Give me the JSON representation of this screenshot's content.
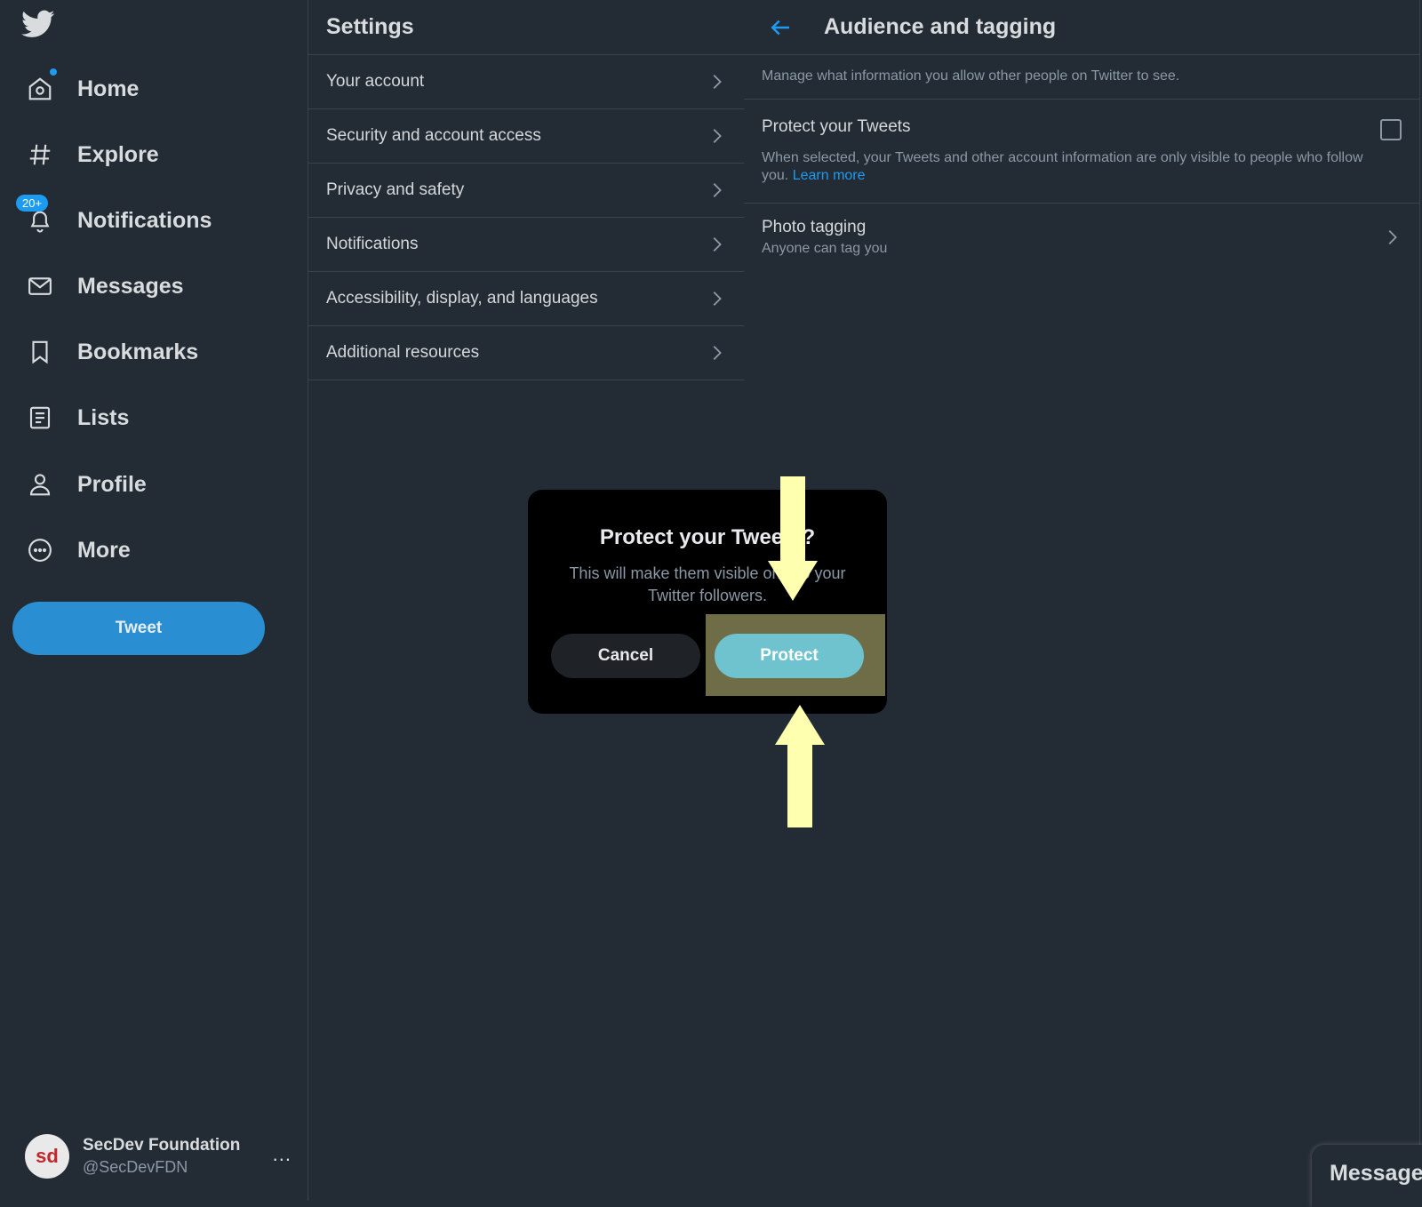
{
  "sidebar": {
    "items": [
      {
        "label": "Home",
        "icon": "home-icon"
      },
      {
        "label": "Explore",
        "icon": "hashtag-icon"
      },
      {
        "label": "Notifications",
        "icon": "bell-icon",
        "badge": "20+"
      },
      {
        "label": "Messages",
        "icon": "envelope-icon"
      },
      {
        "label": "Bookmarks",
        "icon": "bookmark-icon"
      },
      {
        "label": "Lists",
        "icon": "list-icon"
      },
      {
        "label": "Profile",
        "icon": "person-icon"
      },
      {
        "label": "More",
        "icon": "more-circle-icon"
      }
    ],
    "tweet_label": "Tweet",
    "account": {
      "name": "SecDev Foundation",
      "handle": "@SecDevFDN",
      "avatar_text": "sd",
      "more": "..."
    }
  },
  "settings": {
    "title": "Settings",
    "rows": [
      {
        "label": "Your account"
      },
      {
        "label": "Security and account access"
      },
      {
        "label": "Privacy and safety"
      },
      {
        "label": "Notifications"
      },
      {
        "label": "Accessibility, display, and languages"
      },
      {
        "label": "Additional resources"
      }
    ]
  },
  "detail": {
    "title": "Audience and tagging",
    "description": "Manage what information you allow other people on Twitter to see.",
    "protect": {
      "title": "Protect your Tweets",
      "desc": "When selected, your Tweets and other account information are only visible to people who follow you.",
      "link": "Learn more",
      "checked": false
    },
    "photo": {
      "title": "Photo tagging",
      "sub": "Anyone can tag you"
    }
  },
  "messages_drawer": {
    "label": "Messages"
  },
  "modal": {
    "title": "Protect your Tweets?",
    "text": "This will make them visible only to your Twitter followers.",
    "cancel": "Cancel",
    "protect": "Protect"
  },
  "colors": {
    "accent": "#1d9bf0",
    "background": "#232b34",
    "protect_button": "#6ec3cf",
    "highlight": "#6f6c48",
    "arrow": "#ffffb0"
  }
}
